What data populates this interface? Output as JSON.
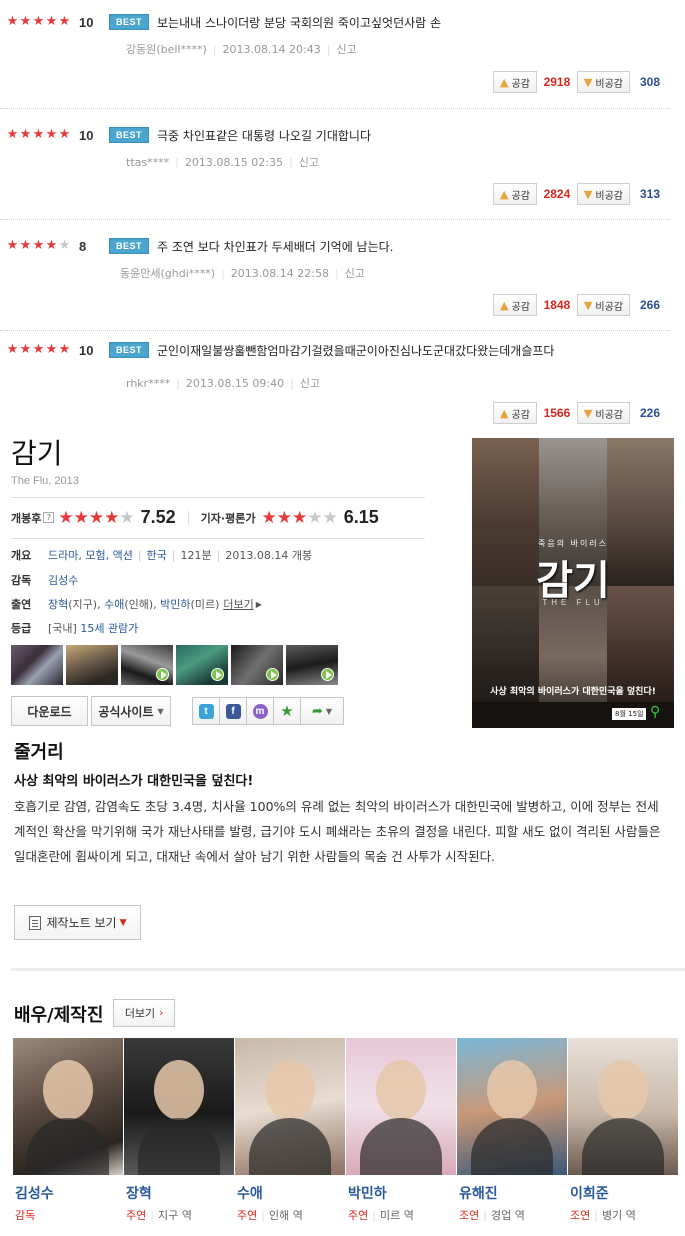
{
  "reviews": [
    {
      "stars": 5,
      "score": "10",
      "badge": "BEST",
      "text": "보는내내 스나이더랑 분당 국회의원 죽이고싶엇던사람 손",
      "author": "강동원(bell****)",
      "date": "2013.08.14 20:43",
      "report": "신고",
      "like_label": "공감",
      "like_count": "2918",
      "dislike_label": "비공감",
      "dislike_count": "308"
    },
    {
      "stars": 5,
      "score": "10",
      "badge": "BEST",
      "text": "극중 차인표같은 대통령 나오길 기대합니다",
      "author": "ttas****",
      "date": "2013.08.15 02:35",
      "report": "신고",
      "like_label": "공감",
      "like_count": "2824",
      "dislike_label": "비공감",
      "dislike_count": "313"
    },
    {
      "stars": 4,
      "score": "8",
      "badge": "BEST",
      "text": "주 조연 보다 차인표가 두세배더 기억에 남는다.",
      "author": "동윤만세(ghdi****)",
      "date": "2013.08.14 22:58",
      "report": "신고",
      "like_label": "공감",
      "like_count": "1848",
      "dislike_label": "비공감",
      "dislike_count": "266"
    },
    {
      "stars": 5,
      "score": "10",
      "badge": "BEST",
      "text": "군인이재일불쌍훌뺀함엄마감기걸렸을때군이아진심나도군대갔다왔는데개슬프다",
      "author": "rhkr****",
      "date": "2013.08.15 09:40",
      "report": "신고",
      "like_label": "공감",
      "like_count": "1566",
      "dislike_label": "비공감",
      "dislike_count": "226"
    }
  ],
  "movie": {
    "title": "감기",
    "subtitle": "The Flu, 2013",
    "audience_label": "개봉후",
    "audience_help": "?",
    "audience_stars": 4,
    "audience_score": "7.52",
    "critic_label": "기자·평론가",
    "critic_stars": 3,
    "critic_score": "6.15",
    "overview_label": "개요",
    "genres": "드라마, 모험, 액션",
    "country": "한국",
    "runtime": "121분",
    "release": "2013.08.14 개봉",
    "director_label": "감독",
    "director": "김성수",
    "cast_label": "출연",
    "cast1": "장혁",
    "cast1_role": "(지구),",
    "cast2": "수애",
    "cast2_role": "(인해),",
    "cast3": "박민하",
    "cast3_role": "(미르)",
    "cast_more": "더보기",
    "rating_label": "등급",
    "rating_region": "[국내]",
    "rating_value": "15세 관람가",
    "download_label": "다운로드",
    "official_label": "공식사이트",
    "poster_tagline": "죽음의 바이러스",
    "poster_title": "감기",
    "poster_en": "THE FLU",
    "poster_copy": "사상 최악의 바이러스가 대한민국을 덮친다!",
    "poster_date": "8월 15일"
  },
  "synopsis": {
    "title": "줄거리",
    "headline": "사상 최악의 바이러스가 대한민국을 덮친다!",
    "body": "호흡기로 감염, 감염속도 초당 3.4명, 치사율 100%의 유례 없는 최악의 바이러스가 대한민국에 발병하고, 이에 정부는 전세계적인 확산을 막기위해 국가 재난사태를 발령, 급기야 도시 폐쇄라는 초유의 결정을 내린다. 피할 새도 없이 격리된 사람들은 일대혼란에 휩싸이게 되고, 대재난 속에서 살아 남기 위한 사람들의 목숨 건 사투가 시작된다.",
    "note_button": "제작노트 보기"
  },
  "crew": {
    "title": "배우/제작진",
    "more": "더보기",
    "people": [
      {
        "name": "김성수",
        "type": "감독",
        "role": ""
      },
      {
        "name": "장혁",
        "type": "주연",
        "role": "지구 역"
      },
      {
        "name": "수애",
        "type": "주연",
        "role": "인해 역"
      },
      {
        "name": "박민하",
        "type": "주연",
        "role": "미르 역"
      },
      {
        "name": "유해진",
        "type": "조연",
        "role": "경업 역"
      },
      {
        "name": "이희준",
        "type": "조연",
        "role": "병기 역"
      }
    ]
  },
  "colors": {
    "star_on": "#e63a3a",
    "link": "#2a5a9c",
    "like": "#d6281e",
    "best_badge": "#4aa6cf"
  }
}
